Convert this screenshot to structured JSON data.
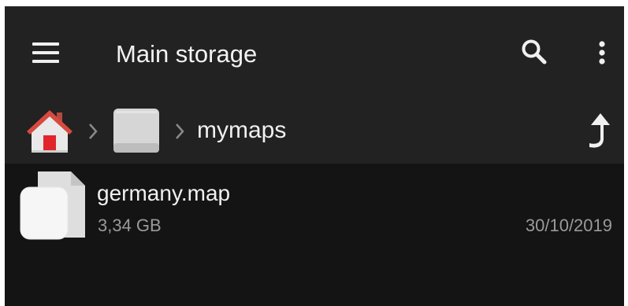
{
  "theme": {
    "background": "#141414",
    "toolbar": "#222222",
    "text_primary": "#f0f0f0",
    "text_secondary": "#9a9a9a"
  },
  "appbar": {
    "title": "Main storage",
    "icons": [
      "menu-icon",
      "search-icon",
      "more-vert-icon"
    ]
  },
  "breadcrumb": {
    "icons": [
      "home-icon",
      "chevron-right-icon",
      "storage-drive-icon",
      "chevron-right-icon",
      "up-arrow-icon"
    ],
    "folder": "mymaps"
  },
  "files": [
    {
      "name": "germany.map",
      "size": "3,34 GB",
      "date": "30/10/2019",
      "icon": "file-icon"
    }
  ]
}
